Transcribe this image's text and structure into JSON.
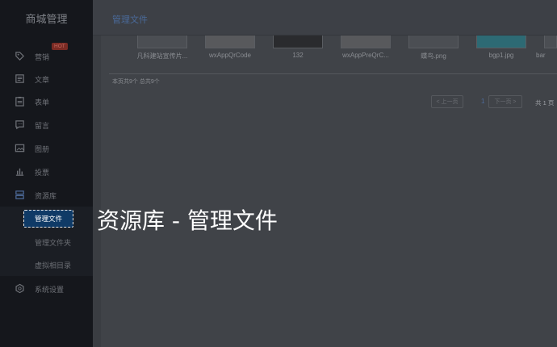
{
  "app": {
    "title": "商城管理"
  },
  "header": {
    "page_title": "管理文件"
  },
  "sidebar": {
    "hot_badge": "HOT",
    "items": [
      {
        "label": "营销",
        "icon": "tag-icon"
      },
      {
        "label": "文章",
        "icon": "article-icon"
      },
      {
        "label": "表单",
        "icon": "form-icon"
      },
      {
        "label": "留言",
        "icon": "message-icon"
      },
      {
        "label": "图册",
        "icon": "image-icon"
      },
      {
        "label": "投票",
        "icon": "chart-icon"
      },
      {
        "label": "资源库",
        "icon": "storage-icon"
      },
      {
        "label": "系统设置",
        "icon": "settings-icon"
      }
    ],
    "sub_items": [
      {
        "label": "管理文件"
      },
      {
        "label": "管理文件夹"
      },
      {
        "label": "虚拟相目录"
      }
    ]
  },
  "files": [
    {
      "name": "凡科建站宣传片..."
    },
    {
      "name": "wxAppQrCode"
    },
    {
      "name": "132"
    },
    {
      "name": "wxAppPreQrC..."
    },
    {
      "name": "蝶鸟.png"
    },
    {
      "name": "bgp1.jpg"
    },
    {
      "name": "bar"
    }
  ],
  "summary": "本页共9个 总共9个",
  "pagination": {
    "prev_label": "< 上一页",
    "current_page": "1",
    "next_label": "下一页 >",
    "total_label": "共 1 页"
  },
  "overlay": {
    "caption": "资源库 - 管理文件"
  }
}
